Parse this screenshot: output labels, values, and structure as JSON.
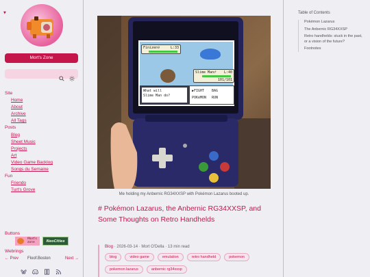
{
  "site": {
    "name": "Mort's Zone"
  },
  "search": {
    "placeholder": ""
  },
  "nav": {
    "site_label": "Site",
    "site_items": [
      "Home",
      "About",
      "Archive",
      "All Tags"
    ],
    "posts_label": "Posts",
    "posts_items": [
      "Blog",
      "Sheet Music",
      "Projects",
      "Art",
      "Video Game Backlog",
      "Songs du Semaine"
    ],
    "fun_label": "Fun",
    "fun_items": [
      "Friendo",
      "Turt's Grove"
    ]
  },
  "buttons": {
    "label": "Buttons",
    "badge1_text": "Mort's zone",
    "badge2_text": "NeoCities"
  },
  "webrings": {
    "label": "Webrings",
    "prev": "← Prev",
    "name": "Floof.Boston",
    "next": "Next →"
  },
  "socials": [
    "bluesky-icon",
    "discord-icon",
    "book-icon",
    "rss-icon"
  ],
  "post": {
    "caption": "Me holding my Anbernic RG34XXSP with Pokémon Lazarus booted up.",
    "title": "# Pokémon Lazarus, the Anbernic RG34XXSP, and Some Thoughts on Retro Handhelds",
    "category": "Blog",
    "date": "2026-03-14",
    "author": "Mort O'Della",
    "read_time": "13 min read",
    "tags": [
      "blog",
      "video game",
      "emulation",
      "retro handheld",
      "pokemon",
      "pokemon lazarus",
      "anbernic rg34xxsp"
    ]
  },
  "game_screen": {
    "enemy_name": "Finizen♀",
    "enemy_level": "L:33",
    "player_name": "Slime Man♂",
    "player_level": "L:40",
    "player_hp": "101/101",
    "prompt_line1": "What will",
    "prompt_line2": "Slime Man do?",
    "options": [
      "▶FIGHT",
      "BAG",
      "POKéMON",
      "RUN"
    ]
  },
  "toc": {
    "heading": "Table of Contents",
    "items": [
      "Pokémon Lazarus",
      "The Anbernic RG34XXSP",
      "Retro handhelds: stuck in the past, or a vision of the future?",
      "Footnotes"
    ]
  },
  "colors": {
    "accent": "#c4164a",
    "background": "#eeeef3",
    "border": "#e9a8bd"
  }
}
